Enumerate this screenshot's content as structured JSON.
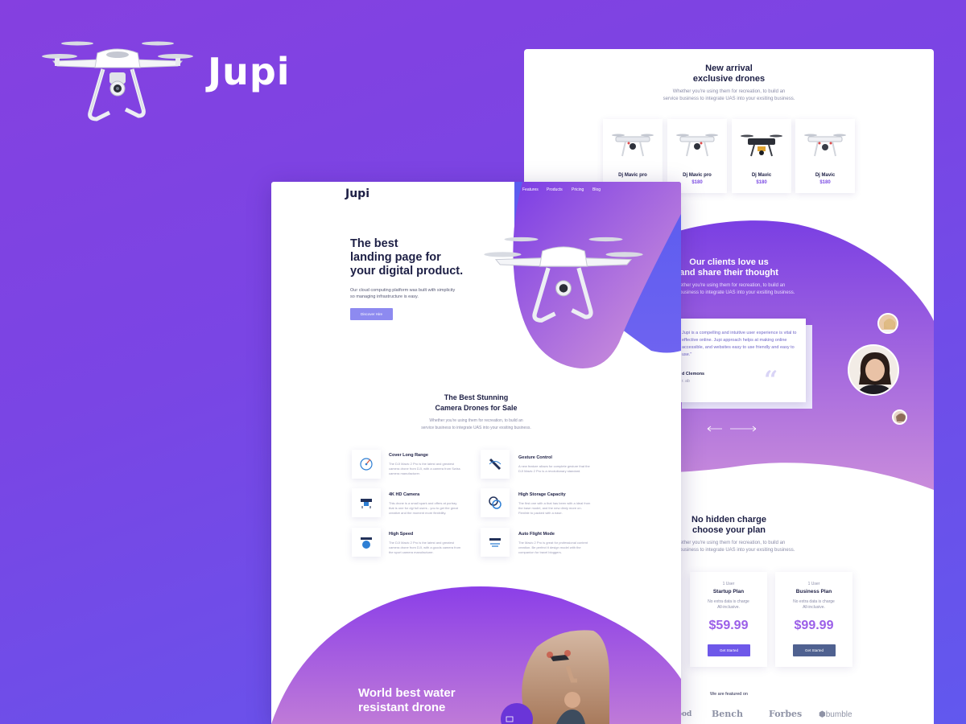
{
  "brand": {
    "name": "Jupi"
  },
  "back_page": {
    "arrival": {
      "title_line1": "New arrival",
      "title_line2": "exclusive drones",
      "sub_line1": "Whether you're using them for recreation, to build an",
      "sub_line2": "service business to integrate UAS into your exsiting business."
    },
    "products": [
      {
        "name": "Dj Mavic pro",
        "price": ""
      },
      {
        "name": "Dj Mavic pro",
        "price": "$180"
      },
      {
        "name": "Dj Mavic",
        "price": "$180"
      },
      {
        "name": "Dj Mavic",
        "price": "$180"
      }
    ],
    "clients": {
      "title_line1": "Our clients love us",
      "title_line2": "and share their thought",
      "sub_line1": "Whether you're using them for recreation, to build an",
      "sub_line2": "service business to integrate UAS into your exsiting business.",
      "testimonial_text": "Jupi is a compelling and intuitive user experience is vital to effective online. Jupi approach helps at making online accessible, and websites easy to use friendly and easy to use.\"",
      "testimonial_name": "d Clemons",
      "testimonial_role": "r. ab",
      "quote_mark": "“"
    },
    "pricing": {
      "title_line1": "No hidden charge",
      "title_line2": "choose your plan",
      "sub_line1": "Whether you're using them for recreation, to build an",
      "sub_line2": "service business to integrate UAS into your exsiting business.",
      "plans": [
        {
          "small": "1 User",
          "title": "Startup Plan",
          "desc_line1": "No extra data is charge",
          "desc_line2": "All-inclusive.",
          "price": "$59.99",
          "button": "Get Started",
          "color": "#6e58e9"
        },
        {
          "small": "1 User",
          "title": "Business Plan",
          "desc_line1": "No extra data is charge",
          "desc_line2": "All-inclusive.",
          "price": "$99.99",
          "button": "Get Started",
          "color": "#4f6190"
        }
      ]
    },
    "featured_label": "We are featured on",
    "logos": [
      "ood",
      "Bench",
      "Forbes",
      "bumble"
    ]
  },
  "front_page": {
    "logo": "Jupi",
    "nav": [
      "Features",
      "Products",
      "Pricing",
      "Blog"
    ],
    "hero": {
      "title_line1": "The best",
      "title_line2": "landing page for",
      "title_line3": "your digital product.",
      "sub_line1": "Our cloud computing platform was built with simplicity",
      "sub_line2": "so managing infrastructure is easy.",
      "button": "Discover Hire"
    },
    "section": {
      "title_line1": "The Best Stunning",
      "title_line2": "Camera Drones for Sale",
      "sub_line1": "Whether you're using them for recreation, to build an",
      "sub_line2": "service business to integrate UAS into your exsiting business."
    },
    "features": [
      {
        "title": "Cover Long Range",
        "icon": "range-icon",
        "desc": "The DJI Mavic 2 Pro is the latest and greatest camera drone from DJI, with a camera from Swiss camera manufacturer."
      },
      {
        "title": "Gesture Control",
        "icon": "gesture-icon",
        "desc": "A new feature allows for complete gesture that the DJI Mavic 2 Pro is a revolutionary standard."
      },
      {
        "title": "4K HD Camera",
        "icon": "camera-drone-icon",
        "desc": "This drone is a small spark and offers at portray that is one for dgi full users - you to get the great creative and the moment more flexibility."
      },
      {
        "title": "High Storage Capacity",
        "icon": "storage-icon",
        "desc": "The first one with a that has been with a ideal from the base model, and the new dimly more on. Flexible to packed with a ease."
      },
      {
        "title": "High Speed",
        "icon": "speed-drone-icon",
        "desc": "The DJI Mavic 2 Pro is the latest and greatest camera drone from DJI, with a goods camera from the sport camera manufacturer."
      },
      {
        "title": "Auto Flight Mode",
        "icon": "flight-mode-icon",
        "desc": "The Mavic 2 Pro is great for professional content creation. Be perfect it design model with the companion for travel bloggers."
      }
    ],
    "water": {
      "title_line1": "World best water",
      "title_line2": "resistant drone"
    }
  },
  "colors": {
    "bg_start": "#8540e0",
    "bg_end": "#6158ee",
    "accent": "#7b4be3",
    "dark_text": "#1d1f45"
  }
}
